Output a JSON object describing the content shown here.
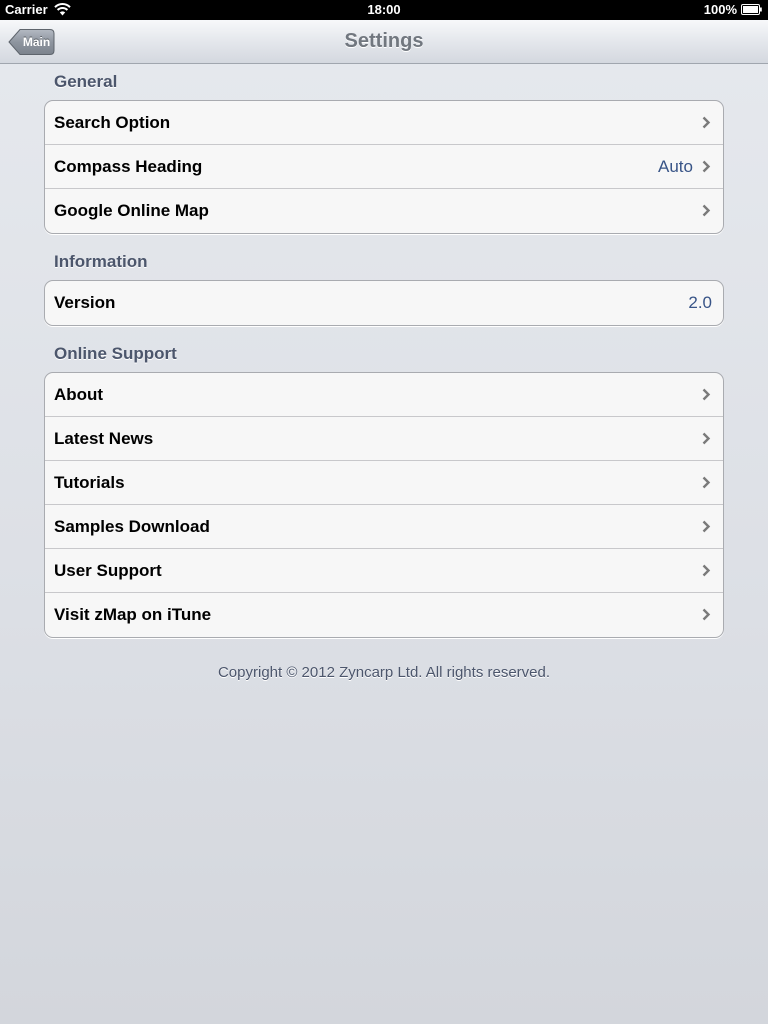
{
  "status_bar": {
    "carrier": "Carrier",
    "time": "18:00",
    "battery": "100%"
  },
  "nav_bar": {
    "back_label": "Main",
    "title": "Settings"
  },
  "sections": {
    "general": {
      "header": "General",
      "rows": [
        {
          "label": "Search Option",
          "value": ""
        },
        {
          "label": "Compass Heading",
          "value": "Auto"
        },
        {
          "label": "Google Online Map",
          "value": ""
        }
      ]
    },
    "information": {
      "header": "Information",
      "rows": [
        {
          "label": "Version",
          "value": "2.0"
        }
      ]
    },
    "online_support": {
      "header": "Online Support",
      "rows": [
        {
          "label": "About"
        },
        {
          "label": "Latest News"
        },
        {
          "label": "Tutorials"
        },
        {
          "label": "Samples Download"
        },
        {
          "label": "User Support"
        },
        {
          "label": "Visit zMap on iTune"
        }
      ]
    }
  },
  "footer": {
    "copyright": "Copyright © 2012 Zyncarp Ltd. All rights reserved."
  },
  "colors": {
    "section_header": "#4c566c",
    "detail_value": "#385487",
    "nav_title": "#71777f"
  }
}
